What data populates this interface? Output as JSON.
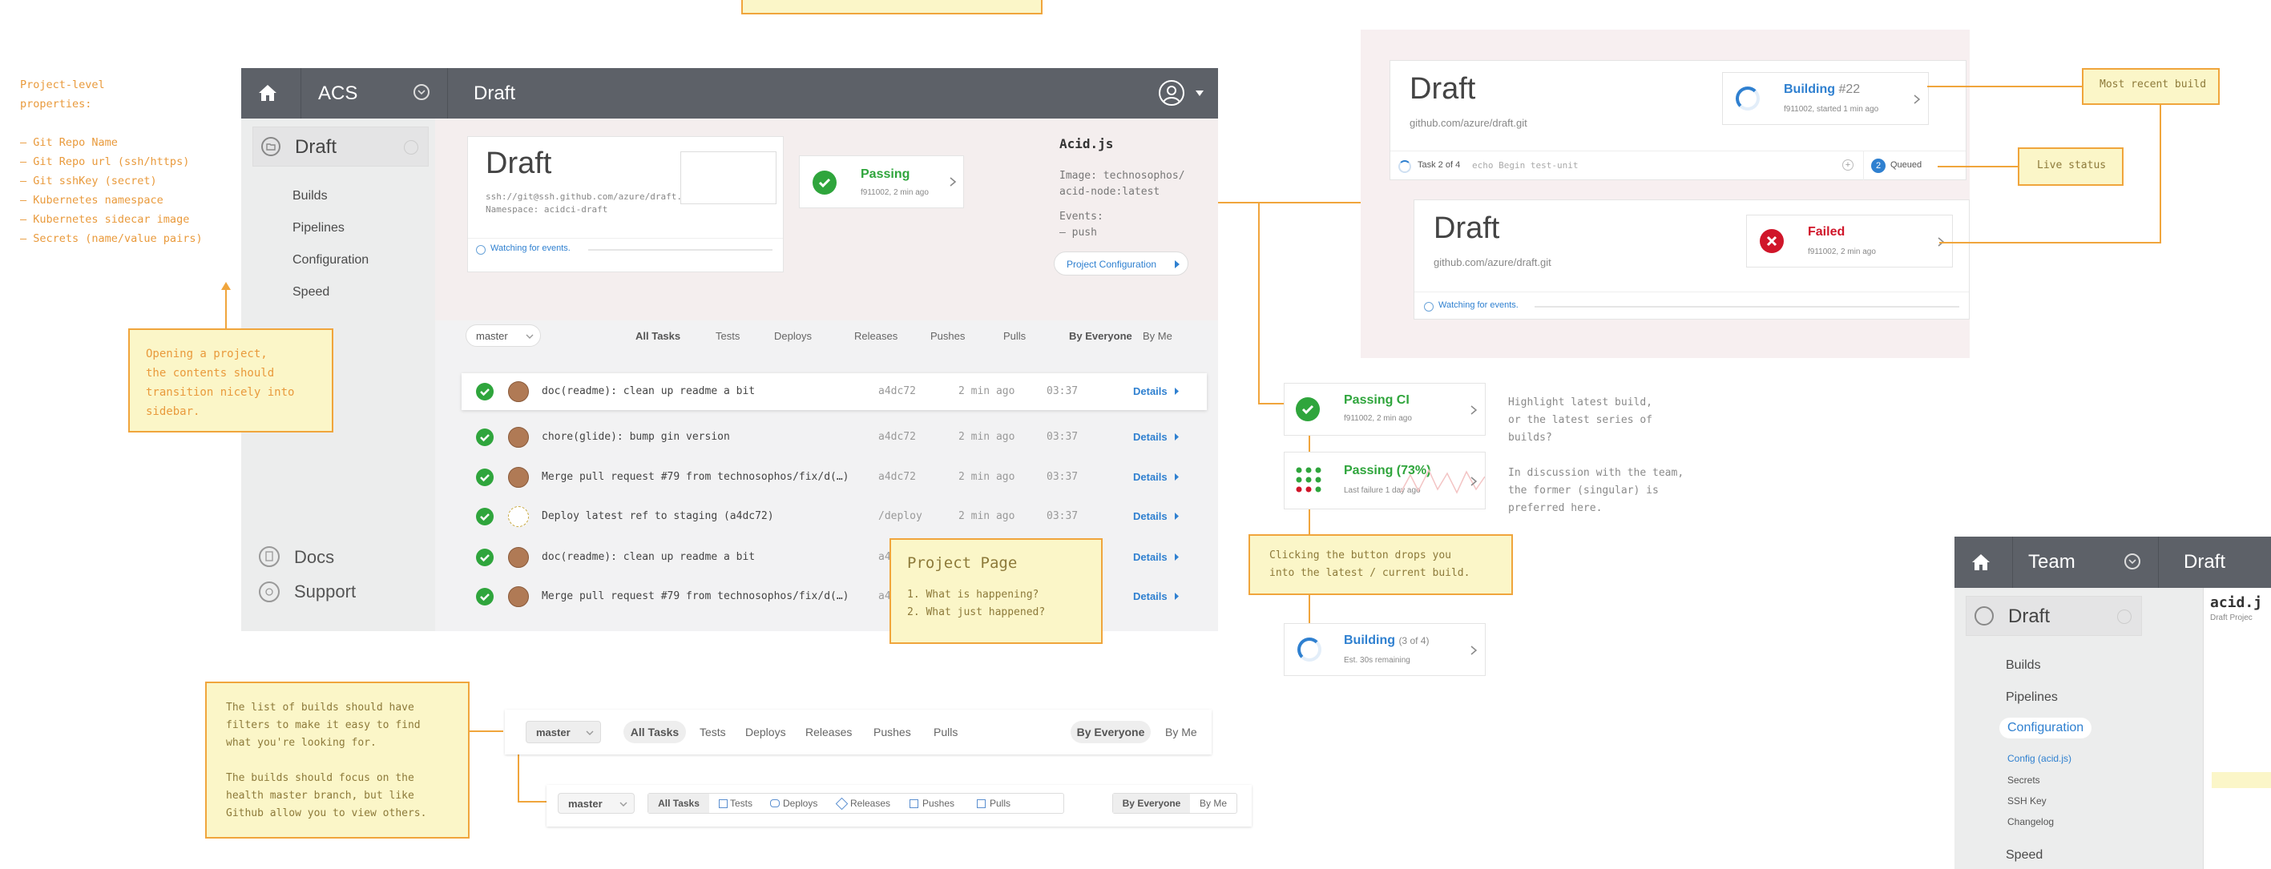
{
  "props_note": {
    "text": "Project-level\nproperties:\n\n– Git Repo Name\n– Git Repo url (ssh/https)\n– Git sshKey (secret)\n– Kubernetes namespace\n– Kubernetes sidecar image\n– Secrets (name/value pairs)"
  },
  "main_app": {
    "breadcrumb": [
      "ACS",
      "Draft"
    ],
    "sidebar": {
      "project": "Draft",
      "items": [
        "Builds",
        "Pipelines",
        "Configuration",
        "Speed"
      ],
      "footer": [
        "Docs",
        "Support"
      ]
    },
    "project_card": {
      "title": "Draft",
      "repo": "ssh://git@ssh.github.com/azure/draft.git",
      "namespace": "Namespace: acidci-draft",
      "status": "Passing",
      "status_meta": "f911002, 2 min ago",
      "watching": "Watching for events."
    },
    "acid": {
      "title": "Acid.js",
      "image": "Image: technosophos/\nacid-node:latest",
      "events": "Events:\n– push",
      "config_button": "Project Configuration"
    },
    "filters": {
      "branch": "master",
      "tabs": [
        "All Tasks",
        "Tests",
        "Deploys",
        "Releases",
        "Pushes",
        "Pulls"
      ],
      "people": [
        "By Everyone",
        "By Me"
      ]
    },
    "builds": [
      {
        "msg": "doc(readme): clean up readme a bit",
        "ref": "a4dc72",
        "time": "2 min ago",
        "dur": "03:37",
        "link": "Details"
      },
      {
        "msg": "chore(glide): bump gin version",
        "ref": "a4dc72",
        "time": "2 min ago",
        "dur": "03:37",
        "link": "Details"
      },
      {
        "msg": "Merge pull request #79 from technosophos/fix/d(…)",
        "ref": "a4dc72",
        "time": "2 min ago",
        "dur": "03:37",
        "link": "Details"
      },
      {
        "msg": "Deploy latest ref to staging (a4dc72)",
        "ref": "/deploy",
        "time": "2 min ago",
        "dur": "03:37",
        "link": "Details"
      },
      {
        "msg": "doc(readme): clean up readme a bit",
        "ref": "a4dc72",
        "time": "2 min ago",
        "dur": "03:37",
        "link": "Details"
      },
      {
        "msg": "Merge pull request #79 from technosophos/fix/d(…)",
        "ref": "a4dc72",
        "time": "2 min ago",
        "dur": "03:37",
        "link": "Details"
      }
    ]
  },
  "notes": {
    "sidebar_transition": "Opening a project,\nthe contents should\ntransition nicely into\nsidebar.",
    "project_page_title": "Project Page",
    "project_page_items": "1. What is happening?\n2. What just happened?",
    "filters_note": "The list of builds should have\nfilters to make it easy to find\nwhat you're looking for.\n\nThe builds should focus on the\nhealth master branch, but like\nGithub allow you to view others.",
    "recent_build": "Most recent build",
    "live_status": "Live status",
    "click_button": "Clicking the button drops you\ninto the latest / current build.",
    "highlight": "Highlight latest build,\nor the latest series of\nbuilds?",
    "discussion": "In discussion with the team,\nthe former (singular) is\npreferred here."
  },
  "status_variants": {
    "passing_ci": {
      "label": "Passing CI",
      "meta": "f911002, 2 min ago"
    },
    "passing_pct": {
      "label": "Passing (73%)",
      "meta": "Last failure 1 day ago"
    },
    "building": {
      "label": "Building",
      "count": "(3 of 4)",
      "meta": "Est. 30s remaining"
    }
  },
  "right_panel": {
    "card1": {
      "title": "Draft",
      "repo": "github.com/azure/draft.git",
      "status": "Building",
      "num": "#22",
      "meta": "f911002, started 1 min ago",
      "task": "Task 2 of 4",
      "cmd": "echo Begin test-unit",
      "queued_count": "2",
      "queued": "Queued"
    },
    "card2": {
      "title": "Draft",
      "repo": "github.com/azure/draft.git",
      "status": "Failed",
      "meta": "f911002, 2 min ago",
      "watching": "Watching for events."
    }
  },
  "filter_bars": {
    "branch": "master",
    "tabs": [
      "All Tasks",
      "Tests",
      "Deploys",
      "Releases",
      "Pushes",
      "Pulls"
    ],
    "people": [
      "By Everyone",
      "By Me"
    ]
  },
  "team_app": {
    "breadcrumb": [
      "Team",
      "Draft"
    ],
    "project": "Draft",
    "items": [
      "Builds",
      "Pipelines",
      "Configuration"
    ],
    "sub_items": [
      "Config (acid.js)",
      "Secrets",
      "SSH Key",
      "Changelog"
    ],
    "speed": "Speed",
    "acid_title": "acid.j",
    "acid_sub": "Draft Projec"
  },
  "colors": {
    "accent": "#f0a53c",
    "sticky": "#fbf6c8",
    "topbar": "#5d6168",
    "green": "#2fa53c",
    "red": "#d0162a",
    "blue": "#2f80d0"
  }
}
